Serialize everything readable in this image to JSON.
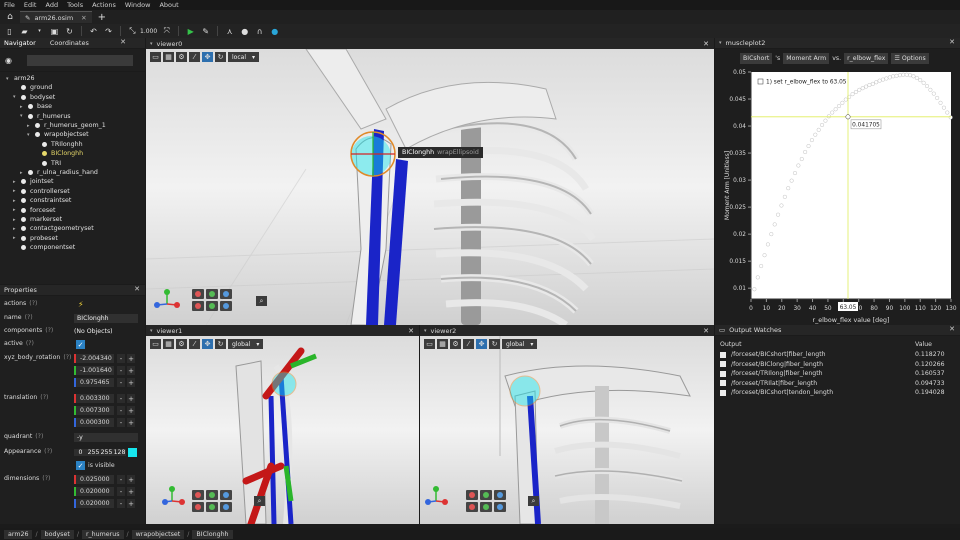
{
  "menu": [
    "File",
    "Edit",
    "Add",
    "Tools",
    "Actions",
    "Window",
    "About"
  ],
  "tabs": {
    "document": "arm26.osim",
    "close": "✕",
    "new": "+"
  },
  "toolbar": {
    "zoom": "1.000"
  },
  "navigator": {
    "tabs": [
      "Navigator",
      "Coordinates"
    ],
    "close": "✕",
    "tree": [
      {
        "label": "arm26",
        "depth": 0,
        "caret": "▾",
        "dot": false
      },
      {
        "label": "ground",
        "depth": 1,
        "caret": "",
        "dot": true
      },
      {
        "label": "bodyset",
        "depth": 1,
        "caret": "▾",
        "dot": true
      },
      {
        "label": "base",
        "depth": 2,
        "caret": "▸",
        "dot": true
      },
      {
        "label": "r_humerus",
        "depth": 2,
        "caret": "▾",
        "dot": true
      },
      {
        "label": "r_humerus_geom_1",
        "depth": 3,
        "caret": "▸",
        "dot": true
      },
      {
        "label": "wrapobjectset",
        "depth": 3,
        "caret": "▾",
        "dot": true
      },
      {
        "label": "TRIlonghh",
        "depth": 4,
        "caret": "",
        "dot": true
      },
      {
        "label": "BIClonghh",
        "depth": 4,
        "caret": "",
        "dot": true,
        "selected": true
      },
      {
        "label": "TRI",
        "depth": 4,
        "caret": "",
        "dot": true
      },
      {
        "label": "r_ulna_radius_hand",
        "depth": 2,
        "caret": "▸",
        "dot": true
      },
      {
        "label": "jointset",
        "depth": 1,
        "caret": "▸",
        "dot": true
      },
      {
        "label": "controllerset",
        "depth": 1,
        "caret": "▸",
        "dot": true
      },
      {
        "label": "constraintset",
        "depth": 1,
        "caret": "▸",
        "dot": true
      },
      {
        "label": "forceset",
        "depth": 1,
        "caret": "▸",
        "dot": true
      },
      {
        "label": "markerset",
        "depth": 1,
        "caret": "▸",
        "dot": true
      },
      {
        "label": "contactgeometryset",
        "depth": 1,
        "caret": "▸",
        "dot": true
      },
      {
        "label": "probeset",
        "depth": 1,
        "caret": "▸",
        "dot": true
      },
      {
        "label": "componentset",
        "depth": 1,
        "caret": "",
        "dot": true
      }
    ]
  },
  "properties": {
    "title": "Properties",
    "q": "(?)",
    "actions_label": "actions",
    "name_label": "name",
    "name_value": "BIClonghh",
    "components_label": "components",
    "components_value": "(No Objects)",
    "active_label": "active",
    "xyz_label": "xyz_body_rotation",
    "xyz": [
      "-2.004340",
      "-1.001640",
      "0.975465"
    ],
    "translation_label": "translation",
    "translation": [
      "0.003300",
      "0.007300",
      "0.000300"
    ],
    "quadrant_label": "quadrant",
    "quadrant_value": "-y",
    "appearance_label": "Appearance",
    "appearance_rgba": [
      "0",
      "255",
      "255",
      "128"
    ],
    "is_visible": "is visible",
    "dimensions_label": "dimensions",
    "dimensions": [
      "0.025000",
      "0.020000",
      "0.020000"
    ],
    "minus": "-",
    "plus": "+"
  },
  "viewers": {
    "v0": {
      "title": "viewer0",
      "frame": "local",
      "tooltip_name": "BIClonghh",
      "tooltip_type": "wrapEllipsoid"
    },
    "v1": {
      "title": "viewer1",
      "frame": "global"
    },
    "v2": {
      "title": "viewer2",
      "frame": "global"
    }
  },
  "plot": {
    "title": "muscleplot2",
    "muscle": "BICshort",
    "possessive": "'s",
    "quantity": "Moment Arm",
    "vs": "vs.",
    "coord": "r_elbow_flex",
    "options": "Options",
    "legend": "1) set r_elbow_flex to 63.05",
    "hover_value": "0.041705",
    "hover_x_label": "63.05",
    "hover_x": 63.05,
    "hover_y": 0.041705
  },
  "chart_data": {
    "type": "scatter",
    "xlabel": "r_elbow_flex value [deg]",
    "ylabel": "Moment Arm [Unitless]",
    "xlim": [
      0,
      130
    ],
    "ylim": [
      0.008,
      0.05
    ],
    "xticks": [
      0,
      10,
      20,
      30,
      40,
      50,
      60,
      70,
      80,
      90,
      100,
      110,
      120,
      130
    ],
    "yticks": [
      0.01,
      0.015,
      0.02,
      0.025,
      0.03,
      0.035,
      0.04,
      0.045,
      0.05
    ],
    "ytick_labels": [
      "0.01",
      "0.015",
      "0.02",
      "0.025",
      "0.03",
      "0.035",
      "0.04",
      "0.045",
      "0.05"
    ],
    "series": [
      {
        "x": [
          0,
          2.2,
          4.4,
          6.6,
          8.8,
          11,
          13.2,
          15.4,
          17.6,
          19.8,
          22,
          24.2,
          26.4,
          28.6,
          30.8,
          33,
          35.2,
          37.4,
          39.6,
          41.8,
          44,
          46.2,
          48.4,
          50.6,
          52.8,
          55,
          57.2,
          59.4,
          61.6,
          63.8,
          66,
          68.2,
          70.4,
          72.6,
          74.8,
          77,
          79.2,
          81.4,
          83.6,
          85.8,
          88,
          90.2,
          92.4,
          94.6,
          96.8,
          99,
          101.2,
          103.4,
          105.6,
          107.8,
          110,
          112.2,
          114.4,
          116.6,
          118.8,
          121,
          123.2,
          125.4,
          127.6,
          129.8
        ],
        "y": [
          0.0076,
          0.0098,
          0.012,
          0.0141,
          0.0161,
          0.0181,
          0.02,
          0.0218,
          0.0236,
          0.0253,
          0.0269,
          0.0285,
          0.0299,
          0.0313,
          0.0327,
          0.0339,
          0.0352,
          0.0363,
          0.0374,
          0.0384,
          0.0393,
          0.0402,
          0.041,
          0.0418,
          0.0425,
          0.0431,
          0.0437,
          0.0443,
          0.0449,
          0.0454,
          0.0459,
          0.0463,
          0.0467,
          0.047,
          0.0473,
          0.0476,
          0.0478,
          0.0481,
          0.0484,
          0.0486,
          0.0488,
          0.049,
          0.0492,
          0.0493,
          0.0494,
          0.0495,
          0.0495,
          0.0494,
          0.0492,
          0.0489,
          0.0485,
          0.048,
          0.0474,
          0.0467,
          0.046,
          0.0452,
          0.0443,
          0.0434,
          0.0425,
          0.0416
        ]
      }
    ]
  },
  "output_watches": {
    "title": "Output Watches",
    "col_output": "Output",
    "col_value": "Value",
    "rows": [
      {
        "output": "/forceset/BICshort|fiber_length",
        "value": "0.118270"
      },
      {
        "output": "/forceset/BIClong|fiber_length",
        "value": "0.120266"
      },
      {
        "output": "/forceset/TRIlong|fiber_length",
        "value": "0.160537"
      },
      {
        "output": "/forceset/TRIlat|fiber_length",
        "value": "0.094733"
      },
      {
        "output": "/forceset/BICshort|tendon_length",
        "value": "0.194028"
      }
    ]
  },
  "breadcrumbs": [
    "arm26",
    "bodyset",
    "r_humerus",
    "wrapobjectset",
    "BIClonghh"
  ],
  "colors": {
    "accent": "#2d6fae",
    "selected": "#e6d86a",
    "plot_marker": "#ffffff",
    "crosshair": "#e0ee5a",
    "muscle_blue": "#1a24c8",
    "wrap_color": "#17e6ee"
  }
}
